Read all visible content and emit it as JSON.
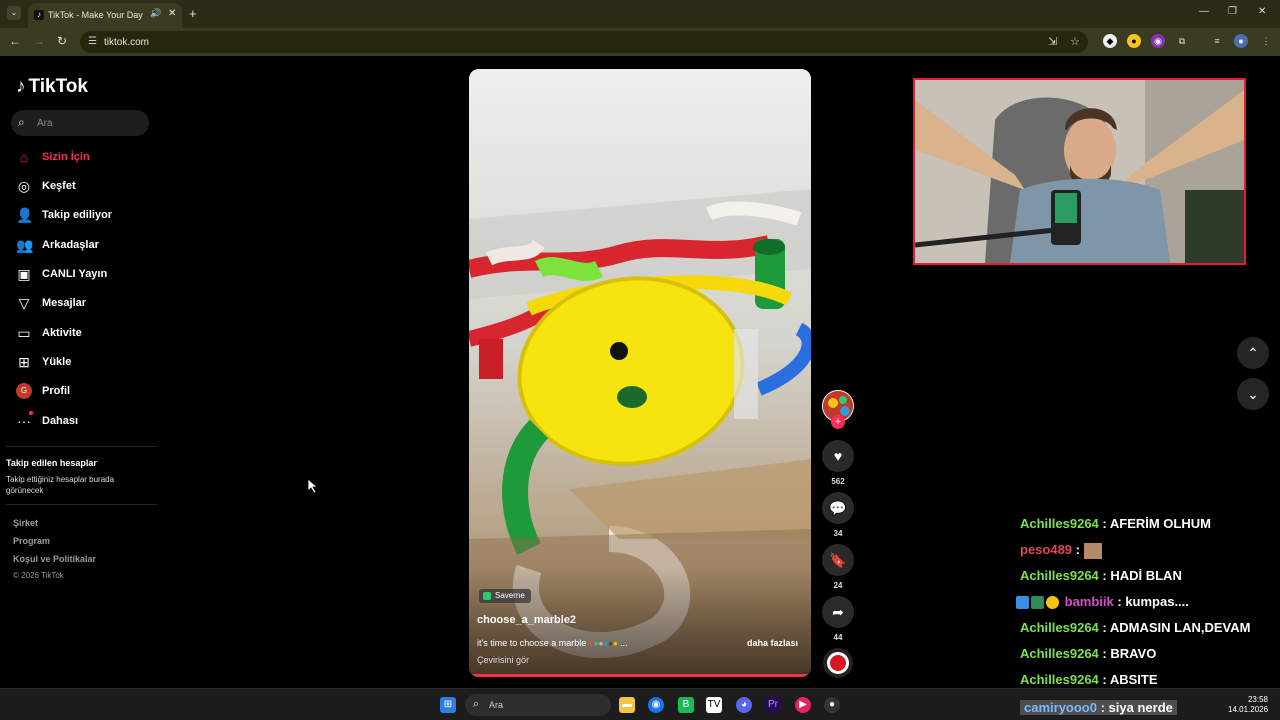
{
  "browser": {
    "tab_title": "TikTok - Make Your Day",
    "tab_mute_icon": "speaker-icon",
    "url": "tiktok.com"
  },
  "sidebar": {
    "logo": "TikTok",
    "search_placeholder": "Ara",
    "items": [
      {
        "label": "Sizin İçin",
        "icon": "home-icon",
        "active": true
      },
      {
        "label": "Keşfet",
        "icon": "compass-icon"
      },
      {
        "label": "Takip ediliyor",
        "icon": "following-icon"
      },
      {
        "label": "Arkadaşlar",
        "icon": "friends-icon"
      },
      {
        "label": "CANLI Yayın",
        "icon": "live-icon"
      },
      {
        "label": "Mesajlar",
        "icon": "messages-icon"
      },
      {
        "label": "Aktivite",
        "icon": "activity-icon"
      },
      {
        "label": "Yükle",
        "icon": "upload-icon"
      },
      {
        "label": "Profil",
        "icon": "profile-avatar",
        "avatar_letter": "G"
      },
      {
        "label": "Dahası",
        "icon": "more-icon"
      }
    ],
    "following_title": "Takip edilen hesaplar",
    "following_text": "Takip ettiğiniz hesaplar burada görünecek",
    "footer": [
      "Şirket",
      "Program",
      "Koşul ve Politikalar"
    ],
    "copyright": "© 2026 TikTok"
  },
  "video": {
    "badge": "Saverne",
    "author": "choose_a_marble2",
    "caption": "it's time to choose a marble",
    "caption_suffix": "...",
    "more": "daha fazlası",
    "translate": "Çevirisini gör",
    "actions": {
      "likes": "562",
      "comments": "34",
      "saves": "24",
      "shares": "44"
    }
  },
  "chat": [
    {
      "nick": "Achilles9264",
      "color": "green",
      "msg": "AFERİM OLHUM"
    },
    {
      "nick": "peso489",
      "color": "red",
      "msg": ""
    },
    {
      "nick": "Achilles9264",
      "color": "green",
      "msg": "HADİ BLAN"
    },
    {
      "nick": "bambiik",
      "color": "pink",
      "msg": "kumpas...."
    },
    {
      "nick": "Achilles9264",
      "color": "green",
      "msg": "ADMASIN LAN,DEVAM"
    },
    {
      "nick": "Achilles9264",
      "color": "green",
      "msg": "BRAVO"
    },
    {
      "nick": "Achilles9264",
      "color": "green",
      "msg": "ABSITE"
    },
    {
      "nick": "camiryooo0",
      "color": "blue",
      "msg": "siya nerde"
    }
  ],
  "taskbar": {
    "search_placeholder": "Ara",
    "time": "23:58",
    "date": "14.01.2026"
  }
}
